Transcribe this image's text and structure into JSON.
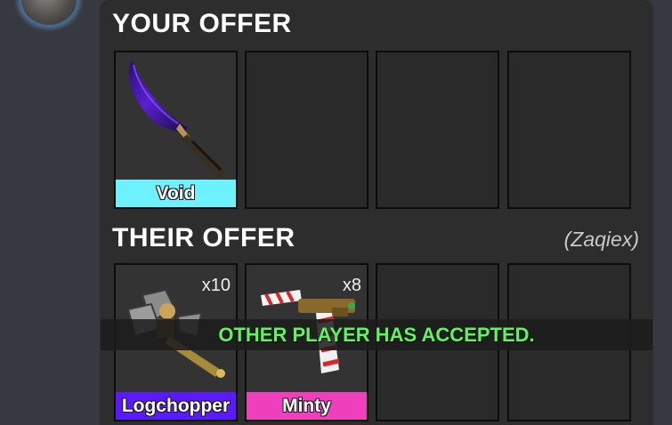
{
  "your_offer": {
    "title": "YOUR OFFER",
    "slots": [
      {
        "name": "Void",
        "label_color": "#6ef1ff",
        "icon": "void-knife-icon"
      },
      {
        "name": ""
      },
      {
        "name": ""
      },
      {
        "name": ""
      }
    ]
  },
  "their_offer": {
    "title": "THEIR OFFER",
    "partner": "(Zaqiex)",
    "slots": [
      {
        "name": "Logchopper",
        "quantity": "x10",
        "label_color": "#5a19ff",
        "icon": "axe-icon"
      },
      {
        "name": "Minty",
        "quantity": "x8",
        "label_color": "#ef3fbd",
        "icon": "candy-cane-gun-icon"
      },
      {
        "name": ""
      },
      {
        "name": ""
      }
    ]
  },
  "status": {
    "message": "OTHER PLAYER HAS ACCEPTED.",
    "color": "#5ff55f"
  },
  "user": {
    "avatar_icon": "avatar-icon"
  }
}
